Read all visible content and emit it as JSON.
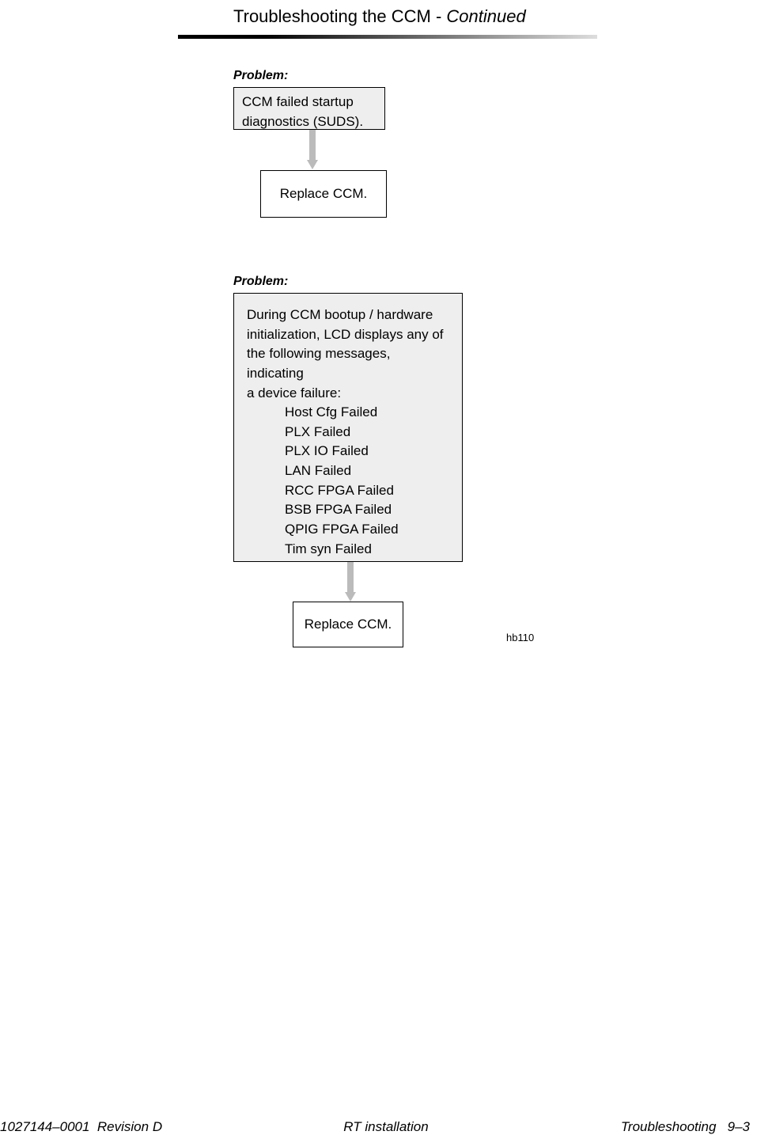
{
  "header": {
    "title_prefix": "Troubleshooting the CCM - ",
    "title_suffix": "Continued"
  },
  "section1": {
    "label": "Problem:",
    "box_line1": "CCM failed startup",
    "box_line2": "diagnostics (SUDS).",
    "action": "Replace CCM."
  },
  "section2": {
    "label": "Problem:",
    "intro1": "During CCM bootup / hardware",
    "intro2": "initialization, LCD displays any of",
    "intro3": "the following messages, indicating",
    "intro4": "a device failure:",
    "messages": [
      "Host Cfg Failed",
      "PLX Failed",
      "PLX IO Failed",
      "LAN Failed",
      "RCC FPGA Failed",
      "BSB FPGA Failed",
      "QPIG FPGA Failed",
      "Tim syn Failed"
    ],
    "action": "Replace CCM.",
    "figure_ref": "hb110"
  },
  "footer": {
    "left": "1027144–0001  Revision D",
    "center": "RT installation",
    "right": "Troubleshooting   9–3"
  }
}
